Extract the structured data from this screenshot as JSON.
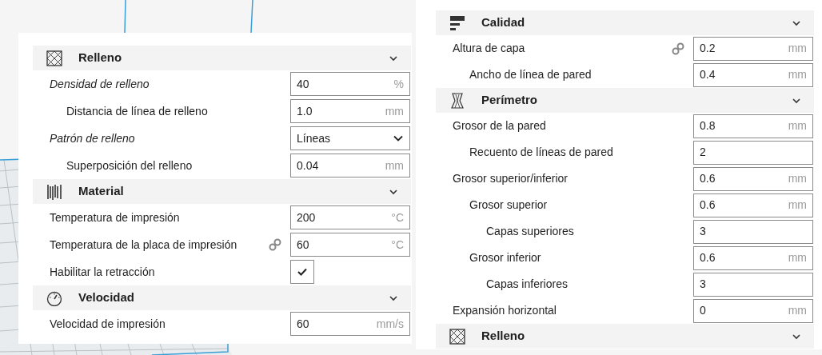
{
  "panels": [
    {
      "sections": [
        {
          "title": "Relleno",
          "kind": "infill",
          "expanded": true,
          "settings": [
            {
              "label": "Densidad de relleno",
              "overridden": true,
              "linked": false,
              "kind": "number",
              "value": "40",
              "unit": "%",
              "children": [
                {
                  "label": "Distancia de línea de relleno",
                  "overridden": false,
                  "linked": false,
                  "kind": "number",
                  "value": "1.0",
                  "unit": "mm"
                }
              ]
            },
            {
              "label": "Patrón de relleno",
              "overridden": true,
              "linked": false,
              "kind": "select",
              "value": "Líneas",
              "children": [
                {
                  "label": "Superposición del relleno",
                  "overridden": false,
                  "linked": false,
                  "kind": "number",
                  "value": "0.04",
                  "unit": "mm"
                }
              ]
            }
          ]
        },
        {
          "title": "Material",
          "kind": "material",
          "expanded": true,
          "settings": [
            {
              "label": "Temperatura de impresión",
              "overridden": false,
              "linked": false,
              "kind": "number",
              "value": "200",
              "unit": "°C"
            },
            {
              "label": "Temperatura de la placa de impresión",
              "overridden": false,
              "linked": true,
              "kind": "number",
              "value": "60",
              "unit": "°C"
            },
            {
              "label": "Habilitar la retracción",
              "overridden": false,
              "linked": false,
              "kind": "checkbox",
              "checked": true
            }
          ]
        },
        {
          "title": "Velocidad",
          "kind": "speed",
          "expanded": true,
          "settings": [
            {
              "label": "Velocidad de impresión",
              "overridden": false,
              "linked": false,
              "kind": "number",
              "value": "60",
              "unit": "mm/s"
            }
          ]
        }
      ]
    },
    {
      "sections": [
        {
          "title": "Calidad",
          "kind": "quality",
          "expanded": true,
          "settings": [
            {
              "label": "Altura de capa",
              "overridden": false,
              "linked": true,
              "kind": "number",
              "value": "0.2",
              "unit": "mm",
              "children": [
                {
                  "label": "Ancho de línea de pared",
                  "overridden": false,
                  "linked": false,
                  "kind": "number",
                  "value": "0.4",
                  "unit": "mm"
                }
              ]
            }
          ]
        },
        {
          "title": "Perímetro",
          "kind": "shell",
          "expanded": true,
          "settings": [
            {
              "label": "Grosor de la pared",
              "overridden": false,
              "linked": false,
              "kind": "number",
              "value": "0.8",
              "unit": "mm",
              "children": [
                {
                  "label": "Recuento de líneas de pared",
                  "overridden": false,
                  "linked": false,
                  "kind": "number",
                  "value": "2"
                }
              ]
            },
            {
              "label": "Grosor superior/inferior",
              "overridden": false,
              "linked": false,
              "kind": "number",
              "value": "0.6",
              "unit": "mm",
              "children": [
                {
                  "label": "Grosor superior",
                  "overridden": false,
                  "linked": false,
                  "kind": "number",
                  "value": "0.6",
                  "unit": "mm",
                  "children": [
                    {
                      "label": "Capas superiores",
                      "overridden": false,
                      "linked": false,
                      "kind": "number",
                      "value": "3"
                    }
                  ]
                },
                {
                  "label": "Grosor inferior",
                  "overridden": false,
                  "linked": false,
                  "kind": "number",
                  "value": "0.6",
                  "unit": "mm",
                  "children": [
                    {
                      "label": "Capas inferiores",
                      "overridden": false,
                      "linked": false,
                      "kind": "number",
                      "value": "3"
                    }
                  ]
                }
              ]
            },
            {
              "label": "Expansión horizontal",
              "overridden": false,
              "linked": false,
              "kind": "number",
              "value": "0",
              "unit": "mm"
            }
          ]
        },
        {
          "title": "Relleno",
          "kind": "infill",
          "expanded": true
        }
      ]
    }
  ]
}
